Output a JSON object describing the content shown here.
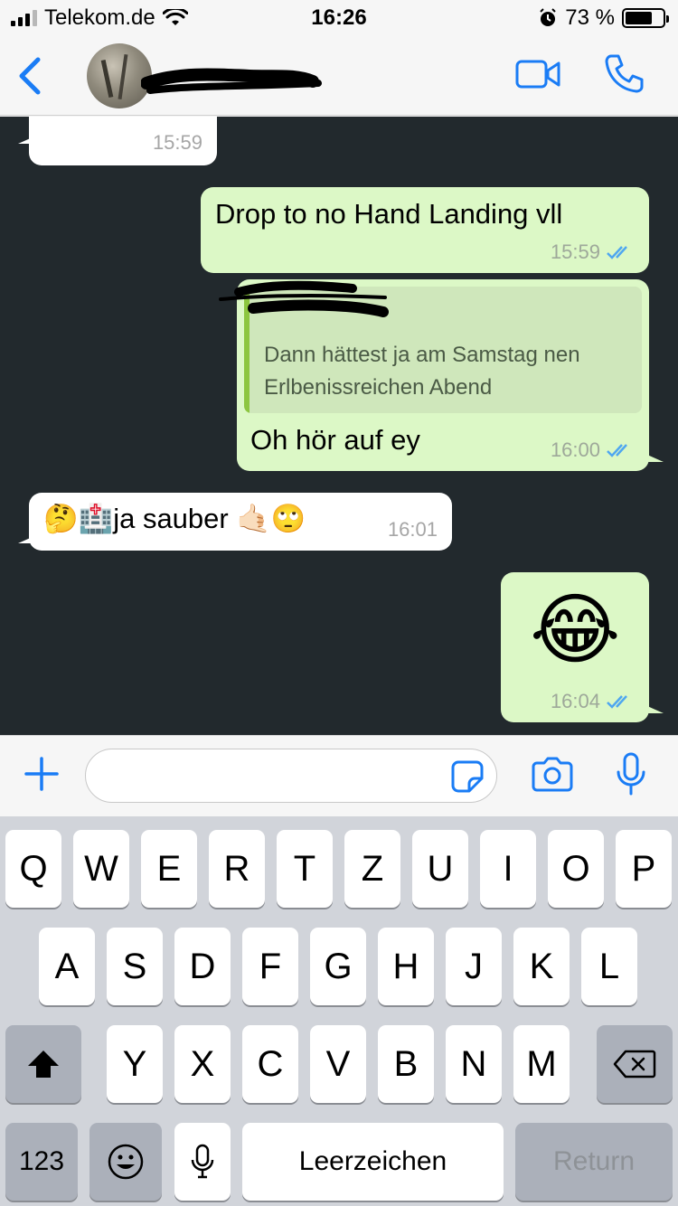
{
  "status": {
    "carrier": "Telekom.de",
    "time": "16:26",
    "battery_pct": "73 %"
  },
  "header": {
    "contact_name": "",
    "video_call": "video-camera-icon",
    "voice_call": "phone-icon"
  },
  "messages": [
    {
      "direction": "in",
      "text": "",
      "time": "15:59"
    },
    {
      "direction": "out",
      "text": "Drop to  no Hand Landing vll",
      "time": "15:59",
      "status": "read"
    },
    {
      "direction": "out",
      "quote_author": "",
      "quote_text": "Dann hättest ja am Samstag nen Erlbenissreichen Abend",
      "text": "Oh hör auf ey",
      "time": "16:00",
      "status": "read"
    },
    {
      "direction": "in",
      "text": "🤔🏥ja sauber 🤙🏻🙄",
      "time": "16:01"
    },
    {
      "direction": "out",
      "text": "😂",
      "time": "16:04",
      "status": "read"
    }
  ],
  "composer": {
    "placeholder": "",
    "icons": [
      "plus-icon",
      "sticker-icon",
      "camera-icon",
      "microphone-icon"
    ]
  },
  "keyboard": {
    "row1": [
      "Q",
      "W",
      "E",
      "R",
      "T",
      "Z",
      "U",
      "I",
      "O",
      "P"
    ],
    "row2": [
      "A",
      "S",
      "D",
      "F",
      "G",
      "H",
      "J",
      "K",
      "L"
    ],
    "row3": [
      "Y",
      "X",
      "C",
      "V",
      "B",
      "N",
      "M"
    ],
    "numbers_key": "123",
    "space_key": "Leerzeichen",
    "return_key": "Return"
  },
  "colors": {
    "accent": "#1a7cf5",
    "chat_bg": "#22292d",
    "out_bubble": "#dcf8c6",
    "in_bubble": "#ffffff",
    "read_ticks": "#4fa7f0"
  }
}
